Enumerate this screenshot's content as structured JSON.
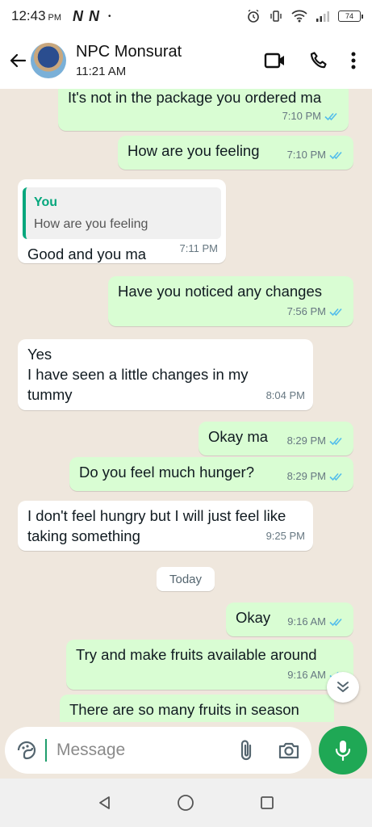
{
  "status_bar": {
    "time": "12:43",
    "ampm": "PM",
    "network_badges": "N N",
    "dot": "•",
    "battery": "74"
  },
  "header": {
    "contact_name": "NPC Monsurat",
    "subtitle": "11:21 AM"
  },
  "messages": [
    {
      "dir": "out",
      "text": "It's not in the package you ordered ma",
      "time": "7:10 PM",
      "ticks": "read"
    },
    {
      "dir": "out",
      "text": "How are you feeling",
      "time": "7:10 PM",
      "ticks": "read"
    },
    {
      "dir": "in",
      "quote_author": "You",
      "quote_text": "How are you feeling",
      "text": "Good and you ma",
      "time": "7:11 PM"
    },
    {
      "dir": "out",
      "text": "Have you noticed any changes",
      "time": "7:56 PM",
      "ticks": "read"
    },
    {
      "dir": "in",
      "text": "Yes\nI have seen a little changes in my tummy",
      "time": "8:04 PM"
    },
    {
      "dir": "out",
      "text": "Okay ma",
      "time": "8:29 PM",
      "ticks": "read"
    },
    {
      "dir": "out",
      "text": "Do you feel much hunger?",
      "time": "8:29 PM",
      "ticks": "read"
    },
    {
      "dir": "in",
      "text": "I don't feel hungry but I will just feel like taking something",
      "time": "9:25 PM"
    },
    {
      "dir": "out",
      "text": "Okay",
      "time": "9:16 AM",
      "ticks": "read"
    },
    {
      "dir": "out",
      "text": "Try and make fruits available around",
      "time": "9:16 AM",
      "ticks": "read"
    },
    {
      "dir": "out",
      "text": "There are so many fruits in season",
      "time": "",
      "ticks": ""
    }
  ],
  "date_chip": "Today",
  "composer": {
    "placeholder": "Message"
  },
  "colors": {
    "outgoing_bubble": "#d9fdd3",
    "incoming_bubble": "#ffffff",
    "chat_background": "#efe7dd",
    "read_ticks": "#53bdeb",
    "mic_button": "#1fa855",
    "quote_accent": "#06a77d"
  },
  "icons": {
    "back": "arrow-left-icon",
    "video_call": "video-camera-icon",
    "voice_call": "phone-icon",
    "menu": "more-vertical-icon",
    "emoji": "sticker-icon",
    "attach": "paperclip-icon",
    "camera": "camera-icon",
    "mic": "microphone-icon",
    "scroll_down": "double-chevron-down-icon"
  }
}
